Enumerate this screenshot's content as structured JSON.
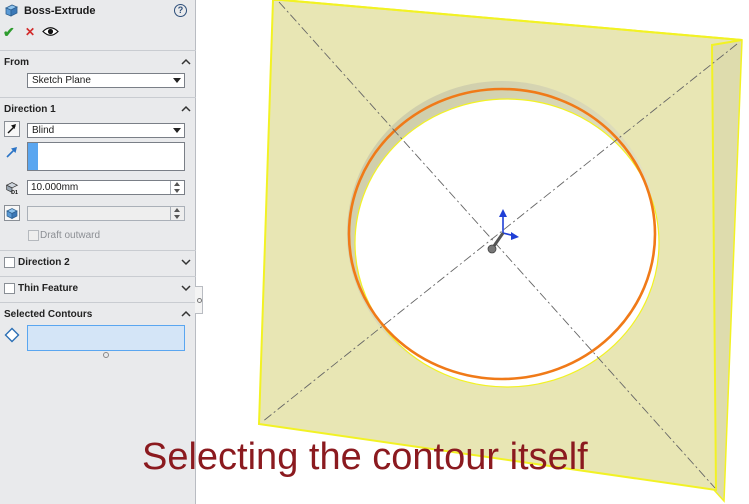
{
  "feature": {
    "title": "Boss-Extrude",
    "help_glyph": "?",
    "ok_glyph": "✔",
    "cancel_glyph": "✕"
  },
  "from": {
    "label": "From",
    "start_condition": "Sketch Plane"
  },
  "direction1": {
    "label": "Direction 1",
    "end_condition": "Blind",
    "depth": "10.000mm",
    "draft_label": "Draft outward"
  },
  "direction2": {
    "label": "Direction 2",
    "checked": false
  },
  "thin_feature": {
    "label": "Thin Feature",
    "checked": false
  },
  "selected_contours": {
    "label": "Selected Contours"
  },
  "caption": "Selecting the contour itself",
  "colors": {
    "accent": "#5aa6f0",
    "face": "#e8e6b4",
    "edge_highlight": "#f2f224",
    "contour": "#f07a18",
    "caption": "#8b1a1f",
    "ok_check": "#2e9c2e",
    "cancel_x": "#d22a2a"
  },
  "icons": [
    "boss-extrude-icon",
    "help-icon",
    "ok-check-icon",
    "cancel-x-icon",
    "preview-eye-icon",
    "reverse-direction-icon",
    "direction-vector-icon",
    "depth-icon",
    "draft-icon",
    "contour-selection-icon",
    "triad-icon"
  ]
}
